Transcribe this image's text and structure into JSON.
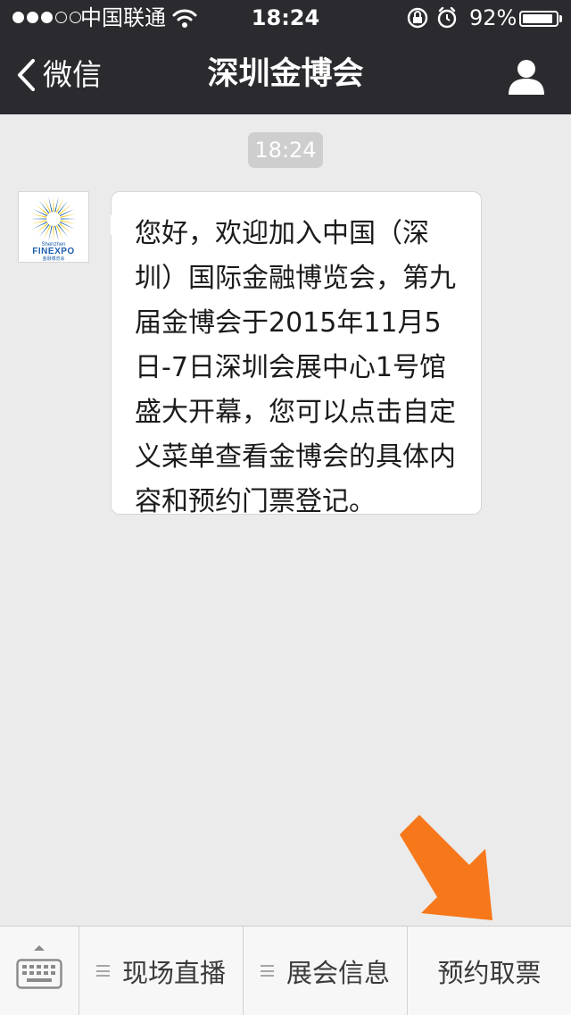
{
  "status_bar": {
    "carrier": "中国联通",
    "time": "18:24",
    "battery_percent": "92%",
    "battery_level": 0.92,
    "signal_bars_filled": 3,
    "signal_bars_total": 5
  },
  "nav": {
    "back_label": "微信",
    "title": "深圳金博会"
  },
  "chat": {
    "timestamp": "18:24",
    "sender_logo": {
      "name": "FINEXPO",
      "sub": "Shenzhen",
      "cn": "金融博览会"
    },
    "message": "您好，欢迎加入中国（深圳）国际金融博览会，第九届金博会于2015年11月5日-7日深圳会展中心1号馆盛大开幕，您可以点击自定义菜单查看金博会的具体内容和预约门票登记。"
  },
  "menu": {
    "items": [
      {
        "label": "现场直播",
        "has_submenu": true
      },
      {
        "label": "展会信息",
        "has_submenu": true
      },
      {
        "label": "预约取票",
        "has_submenu": false
      }
    ]
  },
  "colors": {
    "nav_bg": "#2b2b2f",
    "chat_bg": "#ebebeb",
    "arrow": "#f7781b",
    "logo_blue": "#1d5fae",
    "logo_yellow": "#f2c300"
  }
}
